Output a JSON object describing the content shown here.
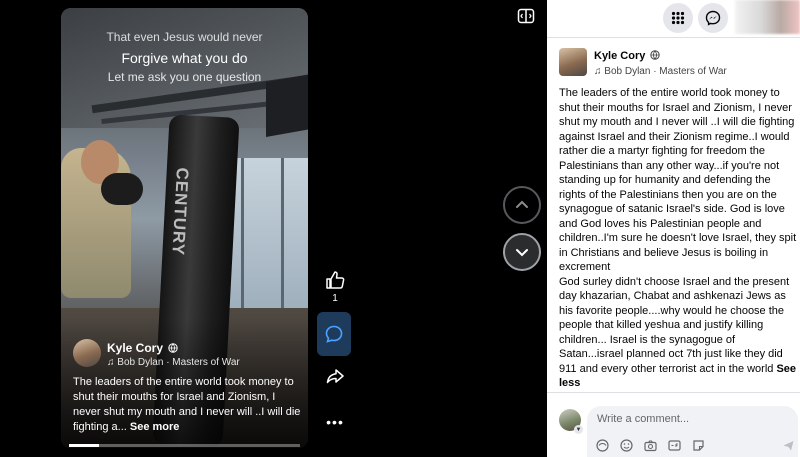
{
  "video": {
    "captions": [
      "That even Jesus would never",
      "Forgive what you do",
      "Let me ask you one question"
    ],
    "bag_text": "CENTURY",
    "author_name": "Kyle Cory",
    "music": "Bob Dylan · Masters of War",
    "text": "The leaders of the entire world took money to shut their mouths for Israel and Zionism, I never shut my mouth and I never will ..I will die fighting a...",
    "see_more": "See more",
    "progress": 0.13
  },
  "actions": {
    "like_count": "1",
    "icons": [
      "like-icon",
      "comment-icon",
      "share-icon",
      "more-icon"
    ]
  },
  "navigation": {
    "icons": [
      "chevron-up-icon",
      "chevron-down-icon",
      "minimize-icon"
    ]
  },
  "topbar": {
    "icons": [
      "menu-grid-icon",
      "messenger-icon"
    ]
  },
  "post": {
    "author_name": "Kyle Cory",
    "music": "Bob Dylan · Masters of War",
    "text": "The leaders of the entire world took money to shut their mouths for Israel and Zionism, I never shut my mouth and I never will ..I will die fighting against Israel and their Zionism regime..I would rather die a martyr fighting for freedom the Palestinians than any other way...if you're not standing up for humanity and defending the rights of the Palestinians then you are on the synagogue of satanic Israel's side. God is love and God loves his Palestinian people and children..I'm sure he doesn't love Israel, they spit in Christians and believe Jesus is boiling in excrement\nGod surley didn't choose Israel and the present day khazarian, Chabat and ashkenazi Jews as his favorite people....why would he choose the people that killed yeshua and justify killing children... Israel is the synagogue of Satan...israel planned oct 7th just like they did 911 and every other terrorist act in the world",
    "see_less": "See less"
  },
  "comment": {
    "placeholder": "Write a comment...",
    "tools": [
      "avatar-sticker-icon",
      "emoji-icon",
      "camera-icon",
      "gif-icon",
      "sticker-icon",
      "send-icon"
    ]
  },
  "colors": {
    "panel_bg": "#ffffff",
    "comment_active_bg": "#1f3b5c",
    "text": "#050505"
  }
}
